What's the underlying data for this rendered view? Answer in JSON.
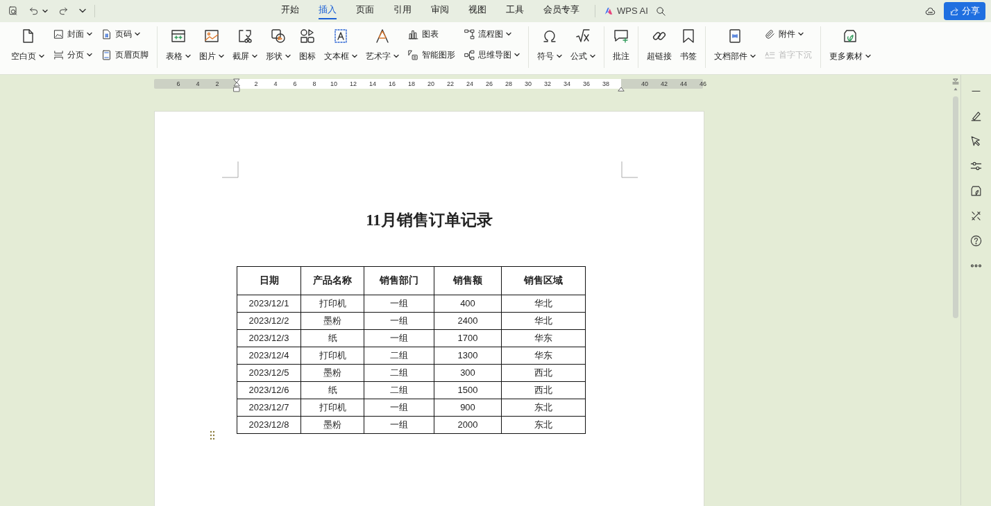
{
  "tabs": [
    {
      "label": "开始",
      "selected": false
    },
    {
      "label": "插入",
      "selected": true
    },
    {
      "label": "页面",
      "selected": false
    },
    {
      "label": "引用",
      "selected": false
    },
    {
      "label": "审阅",
      "selected": false
    },
    {
      "label": "视图",
      "selected": false
    },
    {
      "label": "工具",
      "selected": false
    },
    {
      "label": "会员专享",
      "selected": false
    }
  ],
  "ai_button": {
    "label": "WPS AI"
  },
  "share_button": {
    "label": "分享"
  },
  "ribbon": {
    "groups": [
      {
        "columns": [
          {
            "kind": "large",
            "label": "空白页",
            "caret": true,
            "disabled": false
          },
          {
            "kind": "stack",
            "items": [
              {
                "label": "封面",
                "caret": true,
                "disabled": false
              },
              {
                "label": "分页",
                "caret": true,
                "disabled": false
              }
            ]
          },
          {
            "kind": "stack",
            "items": [
              {
                "label": "页码",
                "caret": true,
                "disabled": false
              },
              {
                "label": "页眉页脚",
                "caret": false,
                "disabled": false
              }
            ]
          }
        ]
      },
      {
        "columns": [
          {
            "kind": "large",
            "label": "表格",
            "caret": true,
            "disabled": false
          },
          {
            "kind": "large",
            "label": "图片",
            "caret": true,
            "disabled": false
          },
          {
            "kind": "large",
            "label": "截屏",
            "caret": true,
            "disabled": false
          },
          {
            "kind": "large",
            "label": "形状",
            "caret": true,
            "disabled": false
          },
          {
            "kind": "large",
            "label": "图标",
            "caret": false,
            "disabled": false
          },
          {
            "kind": "large",
            "label": "文本框",
            "caret": true,
            "disabled": false
          },
          {
            "kind": "large",
            "label": "艺术字",
            "caret": true,
            "disabled": false
          },
          {
            "kind": "stack",
            "items": [
              {
                "label": "图表",
                "caret": false,
                "disabled": false
              },
              {
                "label": "智能图形",
                "caret": false,
                "disabled": false
              }
            ]
          },
          {
            "kind": "stack",
            "items": [
              {
                "label": "流程图",
                "caret": true,
                "disabled": false
              },
              {
                "label": "思维导图",
                "caret": true,
                "disabled": false
              }
            ]
          }
        ]
      },
      {
        "columns": [
          {
            "kind": "large",
            "label": "符号",
            "caret": true,
            "disabled": false
          },
          {
            "kind": "large",
            "label": "公式",
            "caret": true,
            "disabled": false
          }
        ]
      },
      {
        "columns": [
          {
            "kind": "large",
            "label": "批注",
            "caret": false,
            "disabled": false
          }
        ]
      },
      {
        "columns": [
          {
            "kind": "large",
            "label": "超链接",
            "caret": false,
            "disabled": false
          },
          {
            "kind": "large",
            "label": "书签",
            "caret": false,
            "disabled": false
          }
        ]
      },
      {
        "columns": [
          {
            "kind": "large",
            "label": "文档部件",
            "caret": true,
            "disabled": false
          },
          {
            "kind": "stack",
            "items": [
              {
                "label": "附件",
                "caret": true,
                "disabled": false
              },
              {
                "label": "首字下沉",
                "caret": false,
                "disabled": true
              }
            ]
          }
        ]
      },
      {
        "columns": [
          {
            "kind": "large",
            "label": "更多素材",
            "caret": true,
            "disabled": false
          }
        ]
      }
    ]
  },
  "ruler": {
    "left_ticks": [
      "6",
      "4",
      "2"
    ],
    "ticks": [
      "2",
      "4",
      "6",
      "8",
      "10",
      "12",
      "14",
      "16",
      "18",
      "20",
      "22",
      "24",
      "26",
      "28",
      "30",
      "32",
      "34",
      "36",
      "38"
    ],
    "right_ticks": [
      "40",
      "42",
      "44",
      "46"
    ]
  },
  "document": {
    "title": "11月销售订单记录",
    "table": {
      "columns": [
        "日期",
        "产品名称",
        "销售部门",
        "销售额",
        "销售区域"
      ],
      "rows": [
        [
          "2023/12/1",
          "打印机",
          "一组",
          "400",
          "华北"
        ],
        [
          "2023/12/2",
          "墨粉",
          "一组",
          "2400",
          "华北"
        ],
        [
          "2023/12/3",
          "纸",
          "一组",
          "1700",
          "华东"
        ],
        [
          "2023/12/4",
          "打印机",
          "二组",
          "1300",
          "华东"
        ],
        [
          "2023/12/5",
          "墨粉",
          "二组",
          "300",
          "西北"
        ],
        [
          "2023/12/6",
          "纸",
          "二组",
          "1500",
          "西北"
        ],
        [
          "2023/12/7",
          "打印机",
          "一组",
          "900",
          "东北"
        ],
        [
          "2023/12/8",
          "墨粉",
          "一组",
          "2000",
          "东北"
        ]
      ]
    }
  }
}
